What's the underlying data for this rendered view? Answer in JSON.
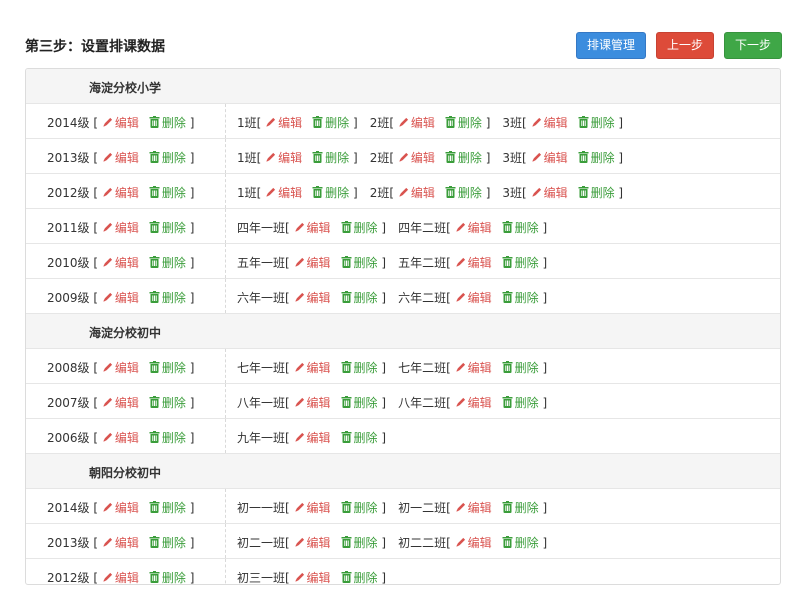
{
  "page": {
    "title": "第三步：设置排课数据",
    "buttons": {
      "schedule": "排课管理",
      "prev": "上一步",
      "next": "下一步"
    },
    "labels": {
      "edit": "编辑",
      "delete": "删除",
      "open": "[",
      "close": "]"
    },
    "colors": {
      "edit": "#d9534f",
      "delete": "#3a9d3a",
      "primary": "#3c8dde",
      "danger": "#dd4b39",
      "success": "#3fa747"
    }
  },
  "schools": [
    {
      "name": "海淀分校小学",
      "grades": [
        {
          "grade": "2014级",
          "classes": [
            "1班",
            "2班",
            "3班"
          ]
        },
        {
          "grade": "2013级",
          "classes": [
            "1班",
            "2班",
            "3班"
          ]
        },
        {
          "grade": "2012级",
          "classes": [
            "1班",
            "2班",
            "3班"
          ]
        },
        {
          "grade": "2011级",
          "classes": [
            "四年一班",
            "四年二班"
          ]
        },
        {
          "grade": "2010级",
          "classes": [
            "五年一班",
            "五年二班"
          ]
        },
        {
          "grade": "2009级",
          "classes": [
            "六年一班",
            "六年二班"
          ]
        }
      ]
    },
    {
      "name": "海淀分校初中",
      "grades": [
        {
          "grade": "2008级",
          "classes": [
            "七年一班",
            "七年二班"
          ]
        },
        {
          "grade": "2007级",
          "classes": [
            "八年一班",
            "八年二班"
          ]
        },
        {
          "grade": "2006级",
          "classes": [
            "九年一班"
          ]
        }
      ]
    },
    {
      "name": "朝阳分校初中",
      "grades": [
        {
          "grade": "2014级",
          "classes": [
            "初一一班",
            "初一二班"
          ]
        },
        {
          "grade": "2013级",
          "classes": [
            "初二一班",
            "初二二班"
          ]
        },
        {
          "grade": "2012级",
          "classes": [
            "初三一班"
          ]
        }
      ]
    }
  ]
}
